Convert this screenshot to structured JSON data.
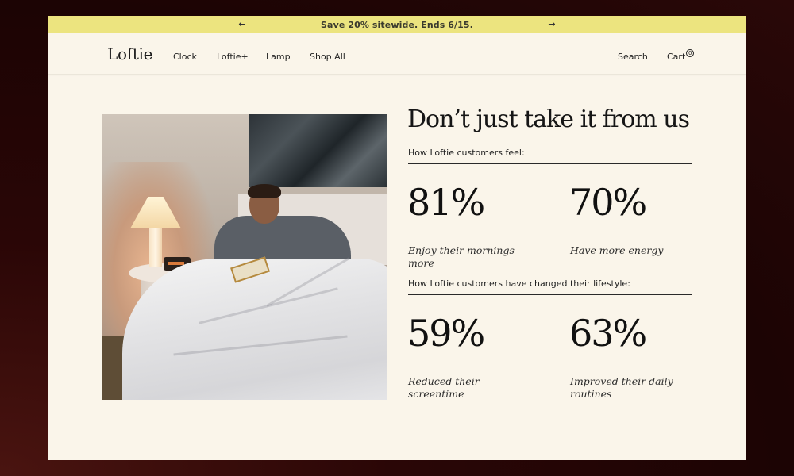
{
  "promo": {
    "prev_icon": "←",
    "next_icon": "→",
    "text": "Save 20% sitewide. Ends 6/15."
  },
  "nav": {
    "logo": "Loftie",
    "links": [
      "Clock",
      "Loftie+",
      "Lamp",
      "Shop All"
    ],
    "search": "Search",
    "cart": "Cart",
    "cart_count": "0"
  },
  "main": {
    "heading": "Don’t just take it from us",
    "image_alt": "Man reading a book in bed next to a lamp and Loftie clock",
    "sections": [
      {
        "label": "How Loftie customers feel:",
        "stats": [
          {
            "value": "81%",
            "caption": "Enjoy their mornings more"
          },
          {
            "value": "70%",
            "caption": "Have more energy"
          }
        ]
      },
      {
        "label": "How Loftie customers have changed their lifestyle:",
        "stats": [
          {
            "value": "59%",
            "caption": "Reduced their screentime"
          },
          {
            "value": "63%",
            "caption": "Improved their daily routines"
          }
        ]
      }
    ]
  },
  "colors": {
    "promo_bg": "#ece47f",
    "page_bg": "#faf5ea",
    "backdrop": "#2a0606",
    "text": "#161616"
  }
}
